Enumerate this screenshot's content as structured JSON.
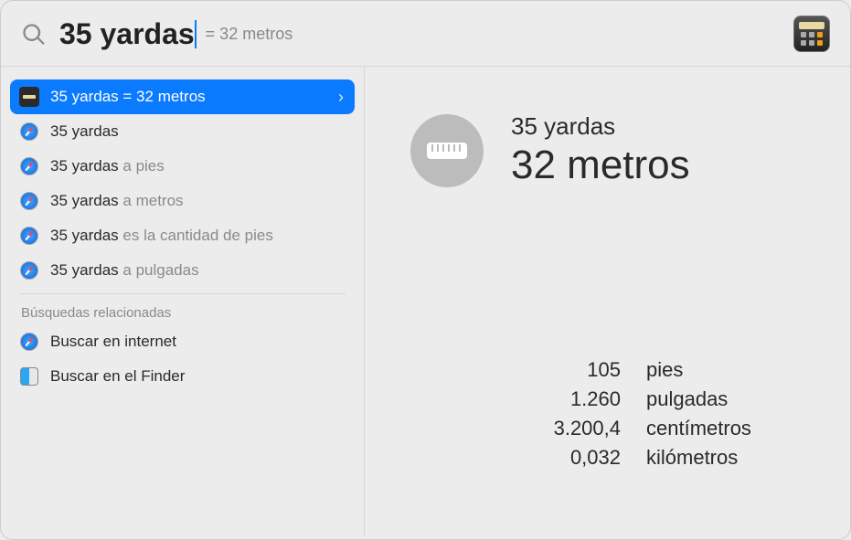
{
  "search": {
    "query": "35 yardas",
    "hint": "= 32 metros"
  },
  "results": {
    "top": {
      "text_input": "35 yardas",
      "text_result": "= 32 metros"
    },
    "suggestions": [
      {
        "query": "35 yardas",
        "suffix": ""
      },
      {
        "query": "35 yardas",
        "suffix": " a pies"
      },
      {
        "query": "35 yardas",
        "suffix": " a metros"
      },
      {
        "query": "35 yardas",
        "suffix": " es la cantidad de pies"
      },
      {
        "query": "35 yardas",
        "suffix": " a pulgadas"
      }
    ],
    "related_header": "Búsquedas relacionadas",
    "related": [
      {
        "label": "Buscar en internet",
        "icon": "safari"
      },
      {
        "label": "Buscar en el Finder",
        "icon": "finder"
      }
    ]
  },
  "preview": {
    "title": "35 yardas",
    "main_value": "32 metros",
    "conversions": [
      {
        "value": "105",
        "unit": "pies"
      },
      {
        "value": "1.260",
        "unit": "pulgadas"
      },
      {
        "value": "3.200,4",
        "unit": "centímetros"
      },
      {
        "value": "0,032",
        "unit": "kilómetros"
      }
    ]
  }
}
